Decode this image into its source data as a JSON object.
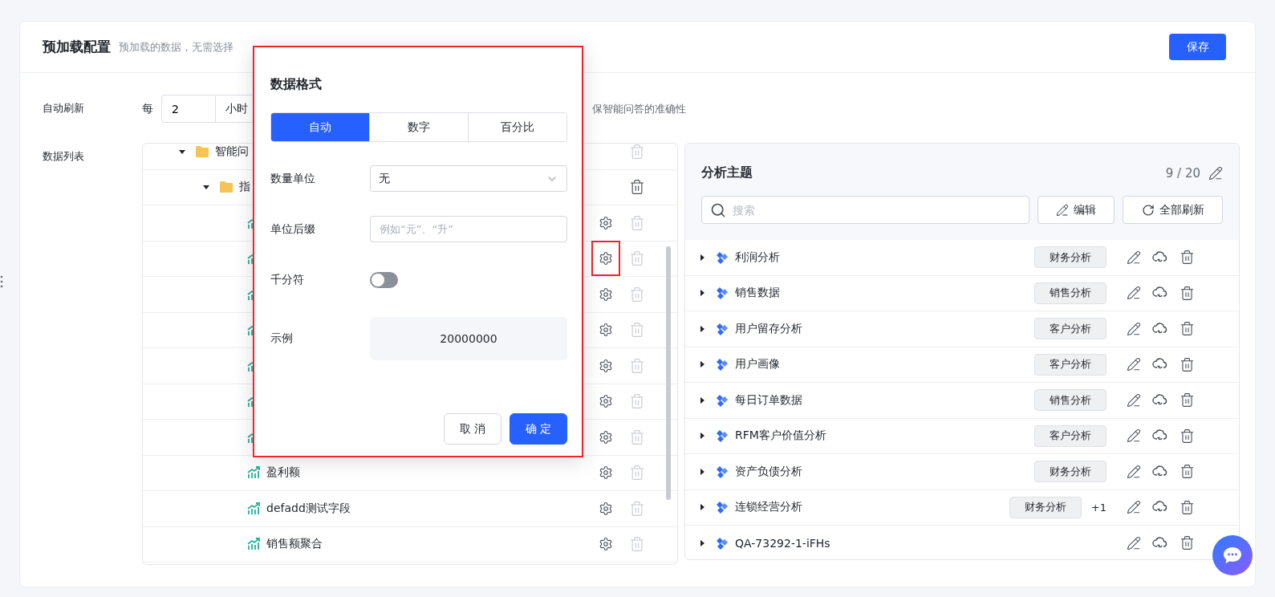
{
  "header": {
    "title": "预加载配置",
    "hint": "预加载的数据，无需选择",
    "save": "保存"
  },
  "refresh": {
    "label": "自动刷新",
    "prefix": "每",
    "value": "2",
    "unit": "小时",
    "hint": "保智能问答的准确性"
  },
  "data_list": {
    "label": "数据列表",
    "tree": [
      {
        "kind": "folder",
        "name": "智能问",
        "expanded": true,
        "delete_disabled": true,
        "children": [
          {
            "kind": "folder",
            "name": "指",
            "expanded": true,
            "delete_disabled": false,
            "children": [
              {
                "kind": "metric",
                "highlighted": false
              },
              {
                "kind": "metric",
                "highlighted": true
              },
              {
                "kind": "metric",
                "highlighted": false
              },
              {
                "kind": "metric",
                "highlighted": false
              },
              {
                "kind": "metric",
                "highlighted": false
              },
              {
                "kind": "metric",
                "highlighted": false
              },
              {
                "kind": "metric",
                "highlighted": false
              },
              {
                "kind": "metric",
                "name": "盈利额",
                "highlighted": false
              },
              {
                "kind": "metric",
                "name": "defadd测试字段",
                "highlighted": false
              },
              {
                "kind": "metric",
                "name": "销售额聚合",
                "highlighted": false
              }
            ]
          }
        ]
      }
    ]
  },
  "topics": {
    "title": "分析主题",
    "count": "9 / 20",
    "search_placeholder": "搜索",
    "edit": "编辑",
    "refresh_all": "全部刷新",
    "items": [
      {
        "name": "利润分析",
        "tags": [
          "财务分析"
        ]
      },
      {
        "name": "销售数据",
        "tags": [
          "销售分析"
        ]
      },
      {
        "name": "用户留存分析",
        "tags": [
          "客户分析"
        ]
      },
      {
        "name": "用户画像",
        "tags": [
          "客户分析"
        ]
      },
      {
        "name": "每日订单数据",
        "tags": [
          "销售分析"
        ]
      },
      {
        "name": "RFM客户价值分析",
        "tags": [
          "客户分析"
        ]
      },
      {
        "name": "资产负债分析",
        "tags": [
          "财务分析"
        ]
      },
      {
        "name": "连锁经营分析",
        "tags": [
          "财务分析"
        ],
        "more": "+1"
      },
      {
        "name": "QA-73292-1-iFHs"
      }
    ]
  },
  "popover": {
    "title": "数据格式",
    "tabs": [
      {
        "label": "自动",
        "selected": true
      },
      {
        "label": "数字",
        "selected": false
      },
      {
        "label": "百分比",
        "selected": false
      }
    ],
    "unit": {
      "label": "数量单位",
      "value": "无"
    },
    "suffix": {
      "label": "单位后缀",
      "placeholder": "例如“元”、“升”"
    },
    "separator": {
      "label": "千分符",
      "on": false
    },
    "example": {
      "label": "示例",
      "value": "20000000"
    },
    "cancel": "取 消",
    "confirm": "确 定"
  }
}
